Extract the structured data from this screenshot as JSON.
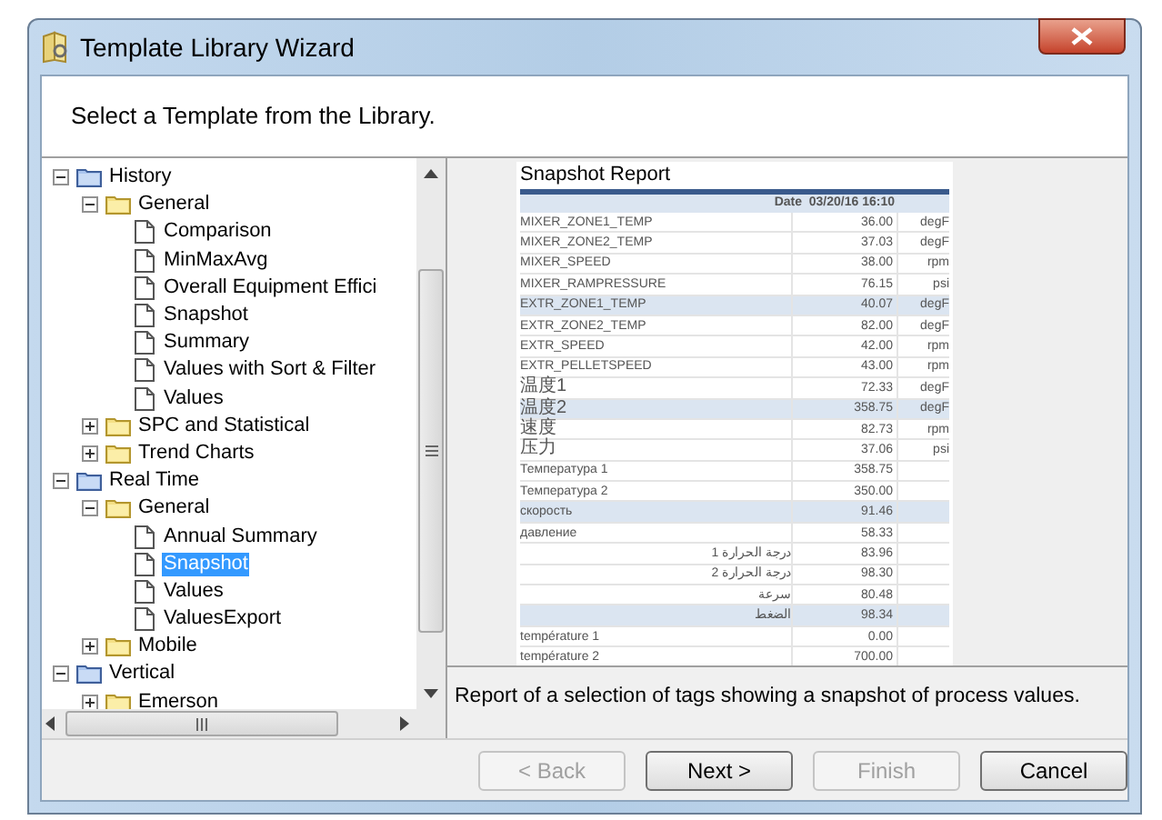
{
  "window": {
    "title": "Template Library Wizard"
  },
  "heading": "Select a Template from the Library.",
  "tree": [
    {
      "label": "History",
      "kind": "root",
      "expanded": true,
      "selected": false,
      "children": [
        {
          "label": "General",
          "kind": "folder",
          "expanded": true,
          "selected": false,
          "children": [
            {
              "label": "Comparison",
              "kind": "template",
              "selected": false
            },
            {
              "label": "MinMaxAvg",
              "kind": "template",
              "selected": false
            },
            {
              "label": "Overall Equipment Effici",
              "kind": "template",
              "selected": false
            },
            {
              "label": "Snapshot",
              "kind": "template",
              "selected": false
            },
            {
              "label": "Summary",
              "kind": "template",
              "selected": false
            },
            {
              "label": "Values with Sort & Filter",
              "kind": "template",
              "selected": false
            },
            {
              "label": "Values",
              "kind": "template",
              "selected": false
            }
          ]
        },
        {
          "label": "SPC and Statistical",
          "kind": "folder",
          "expanded": false,
          "selected": false
        },
        {
          "label": "Trend Charts",
          "kind": "folder",
          "expanded": false,
          "selected": false
        }
      ]
    },
    {
      "label": "Real Time",
      "kind": "root",
      "expanded": true,
      "selected": false,
      "children": [
        {
          "label": "General",
          "kind": "folder",
          "expanded": true,
          "selected": false,
          "children": [
            {
              "label": "Annual Summary",
              "kind": "template",
              "selected": false
            },
            {
              "label": "Snapshot",
              "kind": "template",
              "selected": true
            },
            {
              "label": "Values",
              "kind": "template",
              "selected": false
            },
            {
              "label": "ValuesExport",
              "kind": "template",
              "selected": false
            }
          ]
        },
        {
          "label": "Mobile",
          "kind": "folder",
          "expanded": false,
          "selected": false
        }
      ]
    },
    {
      "label": "Vertical",
      "kind": "root",
      "expanded": true,
      "selected": false,
      "children": [
        {
          "label": "Emerson",
          "kind": "folder",
          "expanded": false,
          "selected": false
        }
      ]
    }
  ],
  "preview": {
    "title": "Snapshot Report",
    "date_label": "Date",
    "date": "03/20/16 16:10",
    "rows": [
      {
        "label": "MIXER_ZONE1_TEMP",
        "value": "36.00",
        "unit": "degF",
        "highlighted": false
      },
      {
        "label": "MIXER_ZONE2_TEMP",
        "value": "37.03",
        "unit": "degF",
        "highlighted": false
      },
      {
        "label": "MIXER_SPEED",
        "value": "38.00",
        "unit": "rpm",
        "highlighted": false
      },
      {
        "label": "MIXER_RAMPRESSURE",
        "value": "76.15",
        "unit": "psi",
        "highlighted": false
      },
      {
        "label": "EXTR_ZONE1_TEMP",
        "value": "40.07",
        "unit": "degF",
        "highlighted": true
      },
      {
        "label": "EXTR_ZONE2_TEMP",
        "value": "82.00",
        "unit": "degF",
        "highlighted": false
      },
      {
        "label": "EXTR_SPEED",
        "value": "42.00",
        "unit": "rpm",
        "highlighted": false
      },
      {
        "label": "EXTR_PELLETSPEED",
        "value": "43.00",
        "unit": "rpm",
        "highlighted": false
      },
      {
        "label": "温度1",
        "value": "72.33",
        "unit": "degF",
        "highlighted": false
      },
      {
        "label": "温度2",
        "value": "358.75",
        "unit": "degF",
        "highlighted": true
      },
      {
        "label": "速度",
        "value": "82.73",
        "unit": "rpm",
        "highlighted": false
      },
      {
        "label": "压力",
        "value": "37.06",
        "unit": "psi",
        "highlighted": false
      },
      {
        "label": "Температура 1",
        "value": "358.75",
        "highlighted": false
      },
      {
        "label": "Температура 2",
        "value": "350.00",
        "highlighted": false
      },
      {
        "label": "скорость",
        "value": "91.46",
        "highlighted": true
      },
      {
        "label": "давление",
        "value": "58.33",
        "highlighted": false
      },
      {
        "label": "درجة الحرارة 1",
        "value": "83.96",
        "highlighted": false
      },
      {
        "label": "درجة الحرارة 2",
        "value": "98.30",
        "highlighted": false
      },
      {
        "label": "سرعة",
        "value": "80.48",
        "highlighted": false
      },
      {
        "label": "الضغط",
        "value": "98.34",
        "highlighted": true
      },
      {
        "label": "température 1",
        "value": "0.00",
        "highlighted": false
      },
      {
        "label": "température 2",
        "value": "700.00",
        "highlighted": false
      }
    ]
  },
  "description": "Report of a selection of tags showing a snapshot of process values.",
  "buttons": [
    {
      "label": "< Back",
      "disabled": true
    },
    {
      "label": "Next >",
      "disabled": false
    },
    {
      "label": "Finish",
      "disabled": true
    },
    {
      "label": "Cancel",
      "disabled": false
    }
  ]
}
